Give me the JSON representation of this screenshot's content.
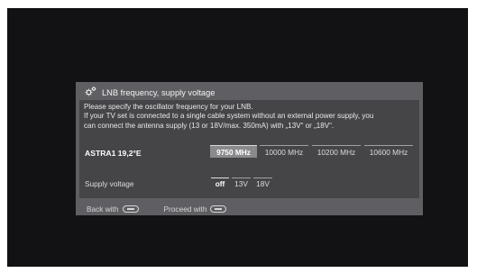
{
  "dialog": {
    "title": "LNB frequency, supply voltage",
    "title_icon": "gear-icon",
    "instructions": [
      "Please specify the oscillator frequency for your LNB.",
      "If your TV set is connected to a single cable system without an external power supply, you",
      "can connect the antenna supply (13 or 18V/max. 350mA) with „13V“ or „18V“."
    ]
  },
  "satellite": {
    "label": "ASTRA1 19,2°E",
    "frequency_options": [
      "9750 MHz",
      "10000 MHz",
      "10200 MHz",
      "10600 MHz"
    ],
    "selected_frequency": "9750 MHz"
  },
  "supply_voltage": {
    "label": "Supply voltage",
    "options": [
      "off",
      "13V",
      "18V"
    ],
    "selected": "off"
  },
  "footer": {
    "back_label": "Back with",
    "back_icon": "remote-back-button-icon",
    "proceed_label": "Proceed with",
    "proceed_icon": "remote-forward-button-icon"
  },
  "colors": {
    "screen_bg": "#121214",
    "dialog_bg": "#5f5f63",
    "panel_bg": "#454548",
    "selected_bg": "#8a8a8e"
  }
}
